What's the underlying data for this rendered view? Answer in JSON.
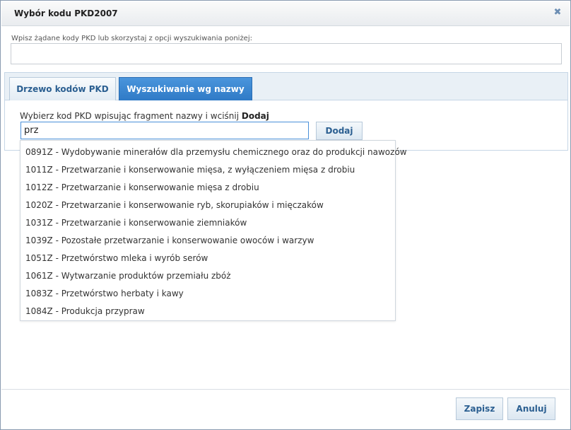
{
  "dialog": {
    "title": "Wybór kodu PKD2007",
    "close_icon": "close-icon"
  },
  "codes_section": {
    "instruction": "Wpisz żądane kody PKD lub skorzystaj z opcji wyszukiwania poniżej:",
    "value": ""
  },
  "tabs": [
    {
      "label": "Drzewo kodów PKD",
      "active": false
    },
    {
      "label": "Wyszukiwanie wg nazwy",
      "active": true
    }
  ],
  "search": {
    "label_prefix": "Wybierz kod PKD wpisując fragment nazwy i wciśnij ",
    "label_bold": "Dodaj",
    "value": "prz",
    "add_button": "Dodaj"
  },
  "suggestions": [
    "0891Z - Wydobywanie minerałów dla przemysłu chemicznego oraz do produkcji nawozów",
    "1011Z - Przetwarzanie i konserwowanie mięsa, z wyłączeniem mięsa z drobiu",
    "1012Z - Przetwarzanie i konserwowanie mięsa z drobiu",
    "1020Z - Przetwarzanie i konserwowanie ryb, skorupiaków i mięczaków",
    "1031Z - Przetwarzanie i konserwowanie ziemniaków",
    "1039Z - Pozostałe przetwarzanie i konserwowanie owoców i warzyw",
    "1051Z - Przetwórstwo mleka i wyrób serów",
    "1061Z - Wytwarzanie produktów przemiału zbóż",
    "1083Z - Przetwórstwo herbaty i kawy",
    "1084Z - Produkcja przypraw"
  ],
  "footer": {
    "save": "Zapisz",
    "cancel": "Anuluj"
  },
  "colors": {
    "accent": "#2f7ac6",
    "link_text": "#2b5f91",
    "tab_strip": "#e9f0f6"
  }
}
